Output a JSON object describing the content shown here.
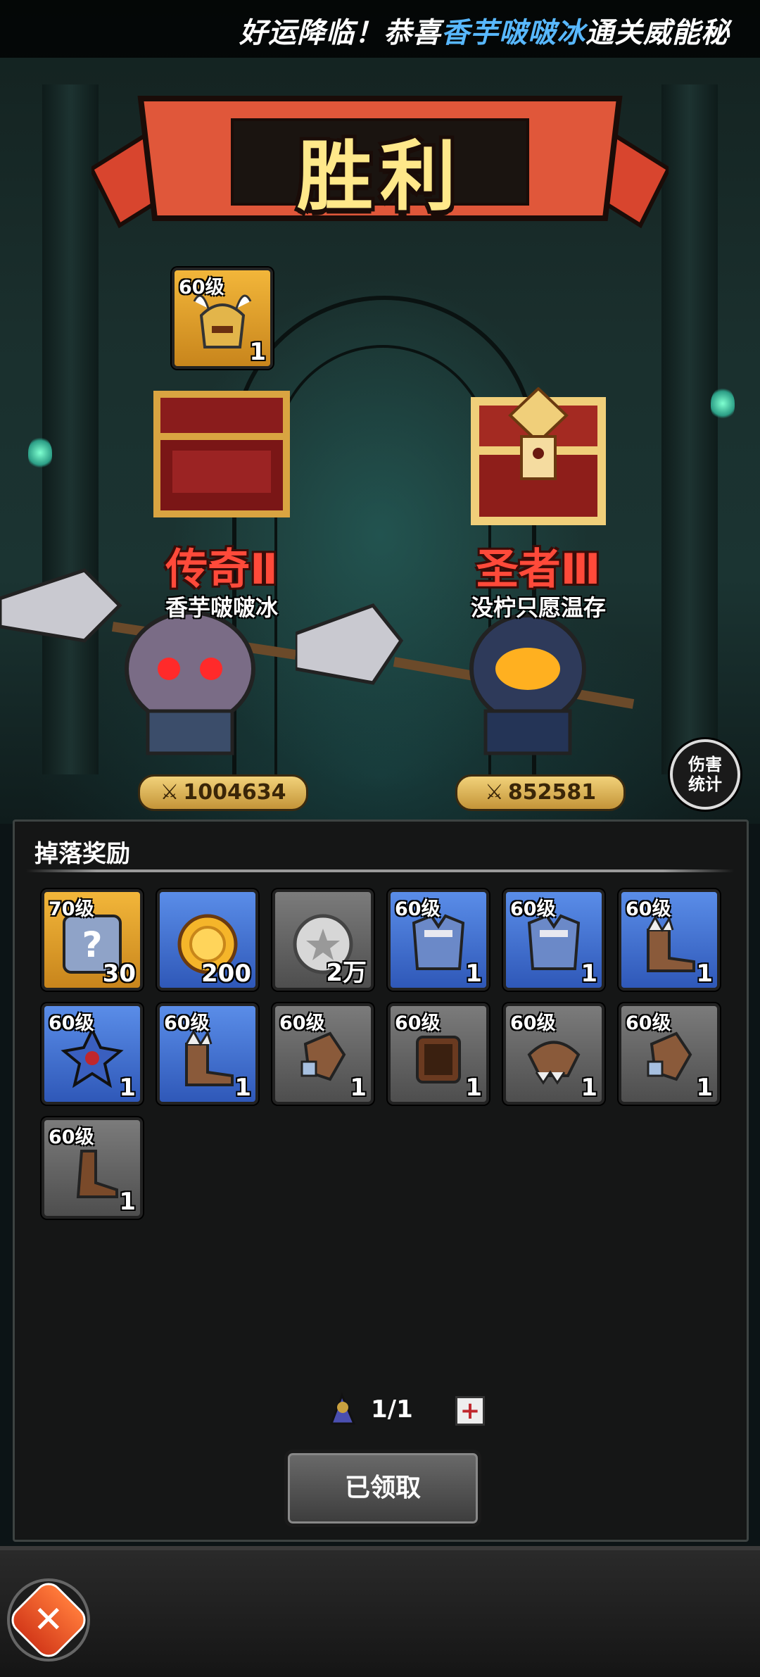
{
  "marquee": {
    "prefix": "好运降临！恭喜",
    "highlight": "香芋啵啵冰",
    "suffix": "通关威能秘"
  },
  "banner": {
    "title": "胜利"
  },
  "top_reward": {
    "level": "60级",
    "count": "1",
    "icon": "horned-helmet-icon"
  },
  "players": [
    {
      "rank": "传奇Ⅱ",
      "name": "香芋啵啵冰",
      "power": "1004634"
    },
    {
      "rank": "圣者Ⅲ",
      "name": "没柠只愿温存",
      "power": "852581"
    }
  ],
  "stats_button": {
    "line1": "伤害",
    "line2": "统计"
  },
  "drops": {
    "title": "掉落奖励",
    "items": [
      {
        "level": "70级",
        "count": "30",
        "rarity": "gold",
        "icon": "mystery-puzzle-icon"
      },
      {
        "level": "",
        "count": "200",
        "rarity": "blue",
        "icon": "gold-coin-icon"
      },
      {
        "level": "",
        "count": "2万",
        "rarity": "gray",
        "icon": "silver-coin-icon"
      },
      {
        "level": "60级",
        "count": "1",
        "rarity": "blue",
        "icon": "chest-armor-icon"
      },
      {
        "level": "60级",
        "count": "1",
        "rarity": "blue",
        "icon": "chest-armor-icon"
      },
      {
        "level": "60级",
        "count": "1",
        "rarity": "blue",
        "icon": "boots-icon"
      },
      {
        "level": "60级",
        "count": "1",
        "rarity": "blue",
        "icon": "spiked-shoulder-icon"
      },
      {
        "level": "60级",
        "count": "1",
        "rarity": "blue",
        "icon": "boots-icon"
      },
      {
        "level": "60级",
        "count": "1",
        "rarity": "gray",
        "icon": "gauntlet-icon"
      },
      {
        "level": "60级",
        "count": "1",
        "rarity": "gray",
        "icon": "bracer-icon"
      },
      {
        "level": "60级",
        "count": "1",
        "rarity": "gray",
        "icon": "shoulder-pad-icon"
      },
      {
        "level": "60级",
        "count": "1",
        "rarity": "gray",
        "icon": "gauntlet-icon"
      },
      {
        "level": "60级",
        "count": "1",
        "rarity": "gray",
        "icon": "boot-icon"
      }
    ]
  },
  "counter": {
    "value": "1/1"
  },
  "claim_button": {
    "label": "已领取"
  },
  "colors": {
    "accent": "#58b8ff",
    "rank_red": "#ff4a3a",
    "title_yellow": "#ffe88a"
  }
}
